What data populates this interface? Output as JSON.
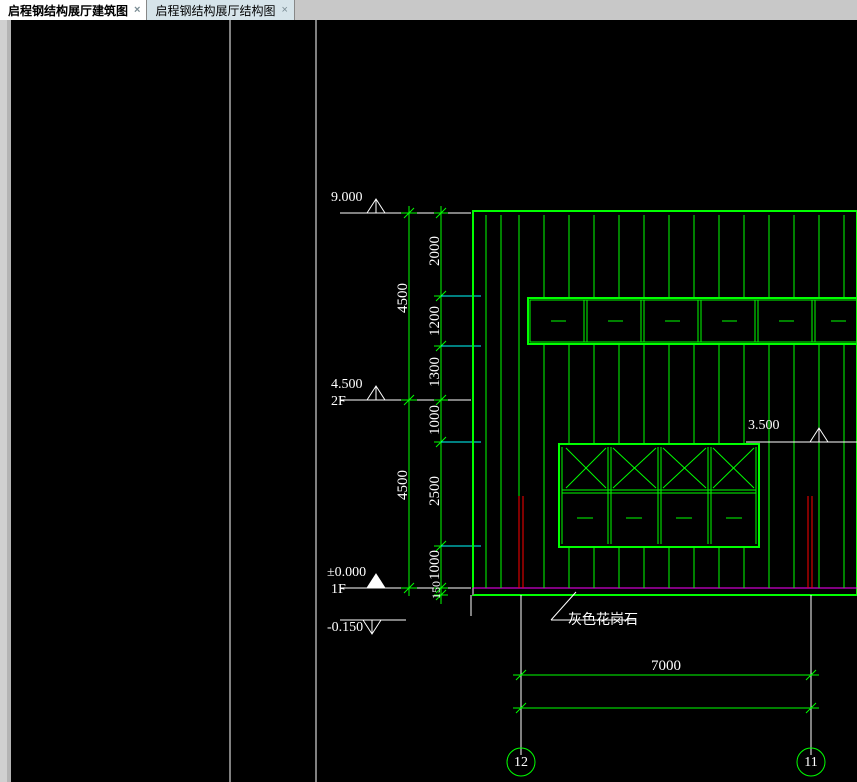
{
  "tabs": [
    {
      "label": "启程钢结构展厅建筑图",
      "active": true
    },
    {
      "label": "启程钢结构展厅结构图",
      "active": false
    }
  ],
  "levels": {
    "top": {
      "elev": "9.000"
    },
    "mid": {
      "elev": "4.500",
      "name": "2F"
    },
    "base": {
      "elev": "±0.000",
      "name": "1F"
    },
    "below": {
      "elev": "-0.150"
    }
  },
  "dims_v_outer": {
    "upper": "4500",
    "lower": "4500"
  },
  "dims_v_inner": {
    "a": "2000",
    "b": "1200",
    "c": "1300",
    "d": "1000",
    "e": "2500",
    "f": "1000",
    "g": "150"
  },
  "dim_h": "7000",
  "note_bottom": "灰色花岗石",
  "elev_right": "3.500",
  "grid": {
    "left": "12",
    "right": "11"
  }
}
